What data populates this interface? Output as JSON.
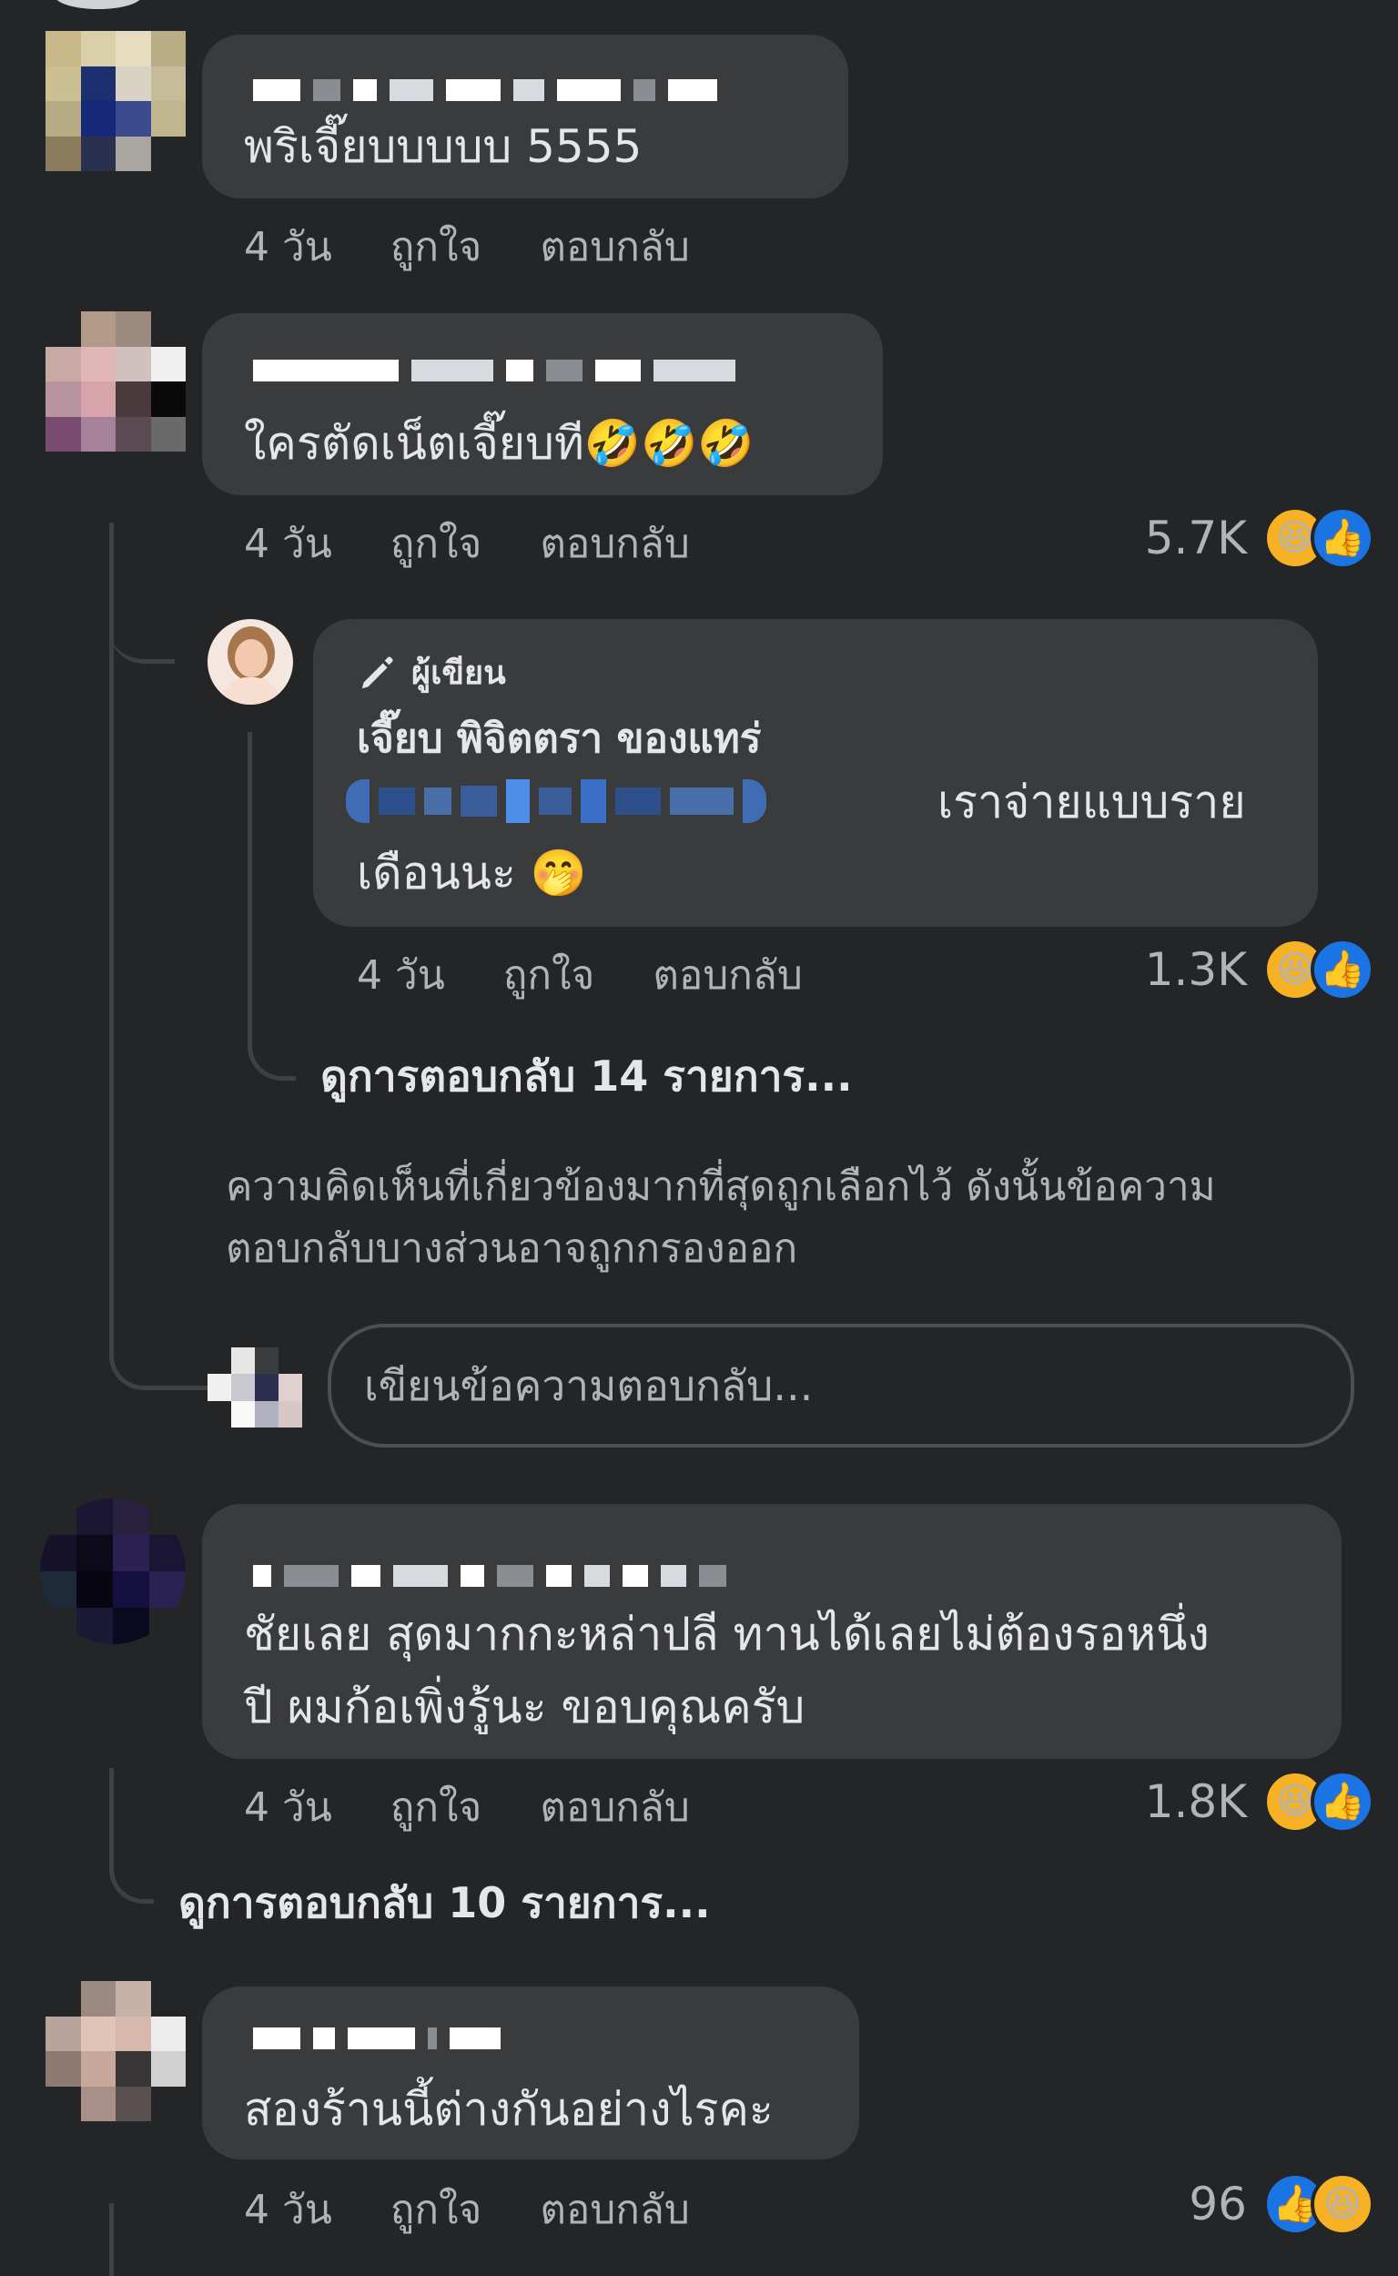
{
  "comments": [
    {
      "text": "พริเจี๊ยบบบบบ 5555",
      "time": "4 วัน",
      "like_label": "ถูกใจ",
      "reply_label": "ตอบกลับ"
    },
    {
      "text": "ใครตัดเน็ตเจี๊ยบที🤣🤣🤣",
      "time": "4 วัน",
      "like_label": "ถูกใจ",
      "reply_label": "ตอบกลับ",
      "reaction_count": "5.7K",
      "reply": {
        "author_badge": "ผู้เขียน",
        "author_name": "เจี๊ยบ พิจิตตรา ของแทร่",
        "text_line1": "เราจ่ายแบบราย",
        "text_line2": "เดือนนะ 🤭",
        "time": "4 วัน",
        "like_label": "ถูกใจ",
        "reply_label": "ตอบกลับ",
        "reaction_count": "1.3K"
      },
      "view_replies": "ดูการตอบกลับ 14 รายการ...",
      "filter_note_line1": "ความคิดเห็นที่เกี่ยวข้องมากที่สุดถูกเลือกไว้ ดังนั้นข้อความ",
      "filter_note_line2": "ตอบกลับบางส่วนอาจถูกกรองออก",
      "reply_placeholder": "เขียนข้อความตอบกลับ..."
    },
    {
      "text_line1": "ชัยเลย สุดมากกะหล่าปลี ทานได้เลยไม่ต้องรอหนึ่ง",
      "text_line2": "ปี ผมก้อเพิ่งรู้นะ ขอบคุณครับ",
      "time": "4 วัน",
      "like_label": "ถูกใจ",
      "reply_label": "ตอบกลับ",
      "reaction_count": "1.8K",
      "view_replies": "ดูการตอบกลับ 10 รายการ..."
    },
    {
      "text": "สองร้านนี้ต่างกันอย่างไรคะ",
      "time": "4 วัน",
      "like_label": "ถูกใจ",
      "reply_label": "ตอบกลับ",
      "reaction_count": "96"
    }
  ],
  "icons": {
    "laugh": "😆",
    "like": "👍",
    "author_badge_icon": "pen-icon"
  },
  "colors": {
    "background": "#242526",
    "bubble": "#3a3b3c",
    "meta_text": "#b0b3b8",
    "like_blue": "#1b74e4",
    "laugh_yellow": "#f7b125"
  }
}
